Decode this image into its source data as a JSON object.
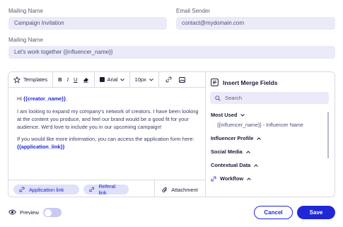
{
  "form": {
    "mailing_name_label": "Mailing Name",
    "mailing_name_value": "Campaign Invitation",
    "email_sender_label": "Email Sender",
    "email_sender_value": "contact@mydomain.com",
    "mailing_name2_label": "Mailing Name",
    "mailing_name2_value": "Let's work together {{influencer_name}}"
  },
  "toolbar": {
    "templates_label": "Templates",
    "bold": "B",
    "italic": "I",
    "underline": "U",
    "font_value": "Arial",
    "size_value": "10px"
  },
  "editor": {
    "greeting_prefix": "Hi ",
    "creator_var": "{{creator_name}}",
    "greeting_suffix": ",",
    "paragraph1": "I am looking to expand my company's network of creators. I have been looking at the content you produce, and feel our brand would be a good fit for your audience. We'd love to include you in our upcoming campaign!",
    "paragraph2_prefix": "If you would like more information, you can access the application form here: ",
    "application_var": "{{application_link}}",
    "chips": [
      "Application link",
      "Referal link"
    ],
    "attachment_label": "Attachment"
  },
  "merge": {
    "title": "Insert Merge Fields",
    "search_placeholder": "Search",
    "most_used_label": "Most Used",
    "most_used_item": "{{influencer_name}} - Influencer Name",
    "sections": [
      "Influencer Profile",
      "Social Media",
      "Contextual Data",
      "Workflow"
    ]
  },
  "footer": {
    "preview_label": "Preview",
    "preview_on": false,
    "cancel_label": "Cancel",
    "save_label": "Save"
  },
  "colors": {
    "accent": "#1f27d6",
    "input_bg": "#ebeaf8",
    "chip_bg": "#dfe0fa"
  }
}
